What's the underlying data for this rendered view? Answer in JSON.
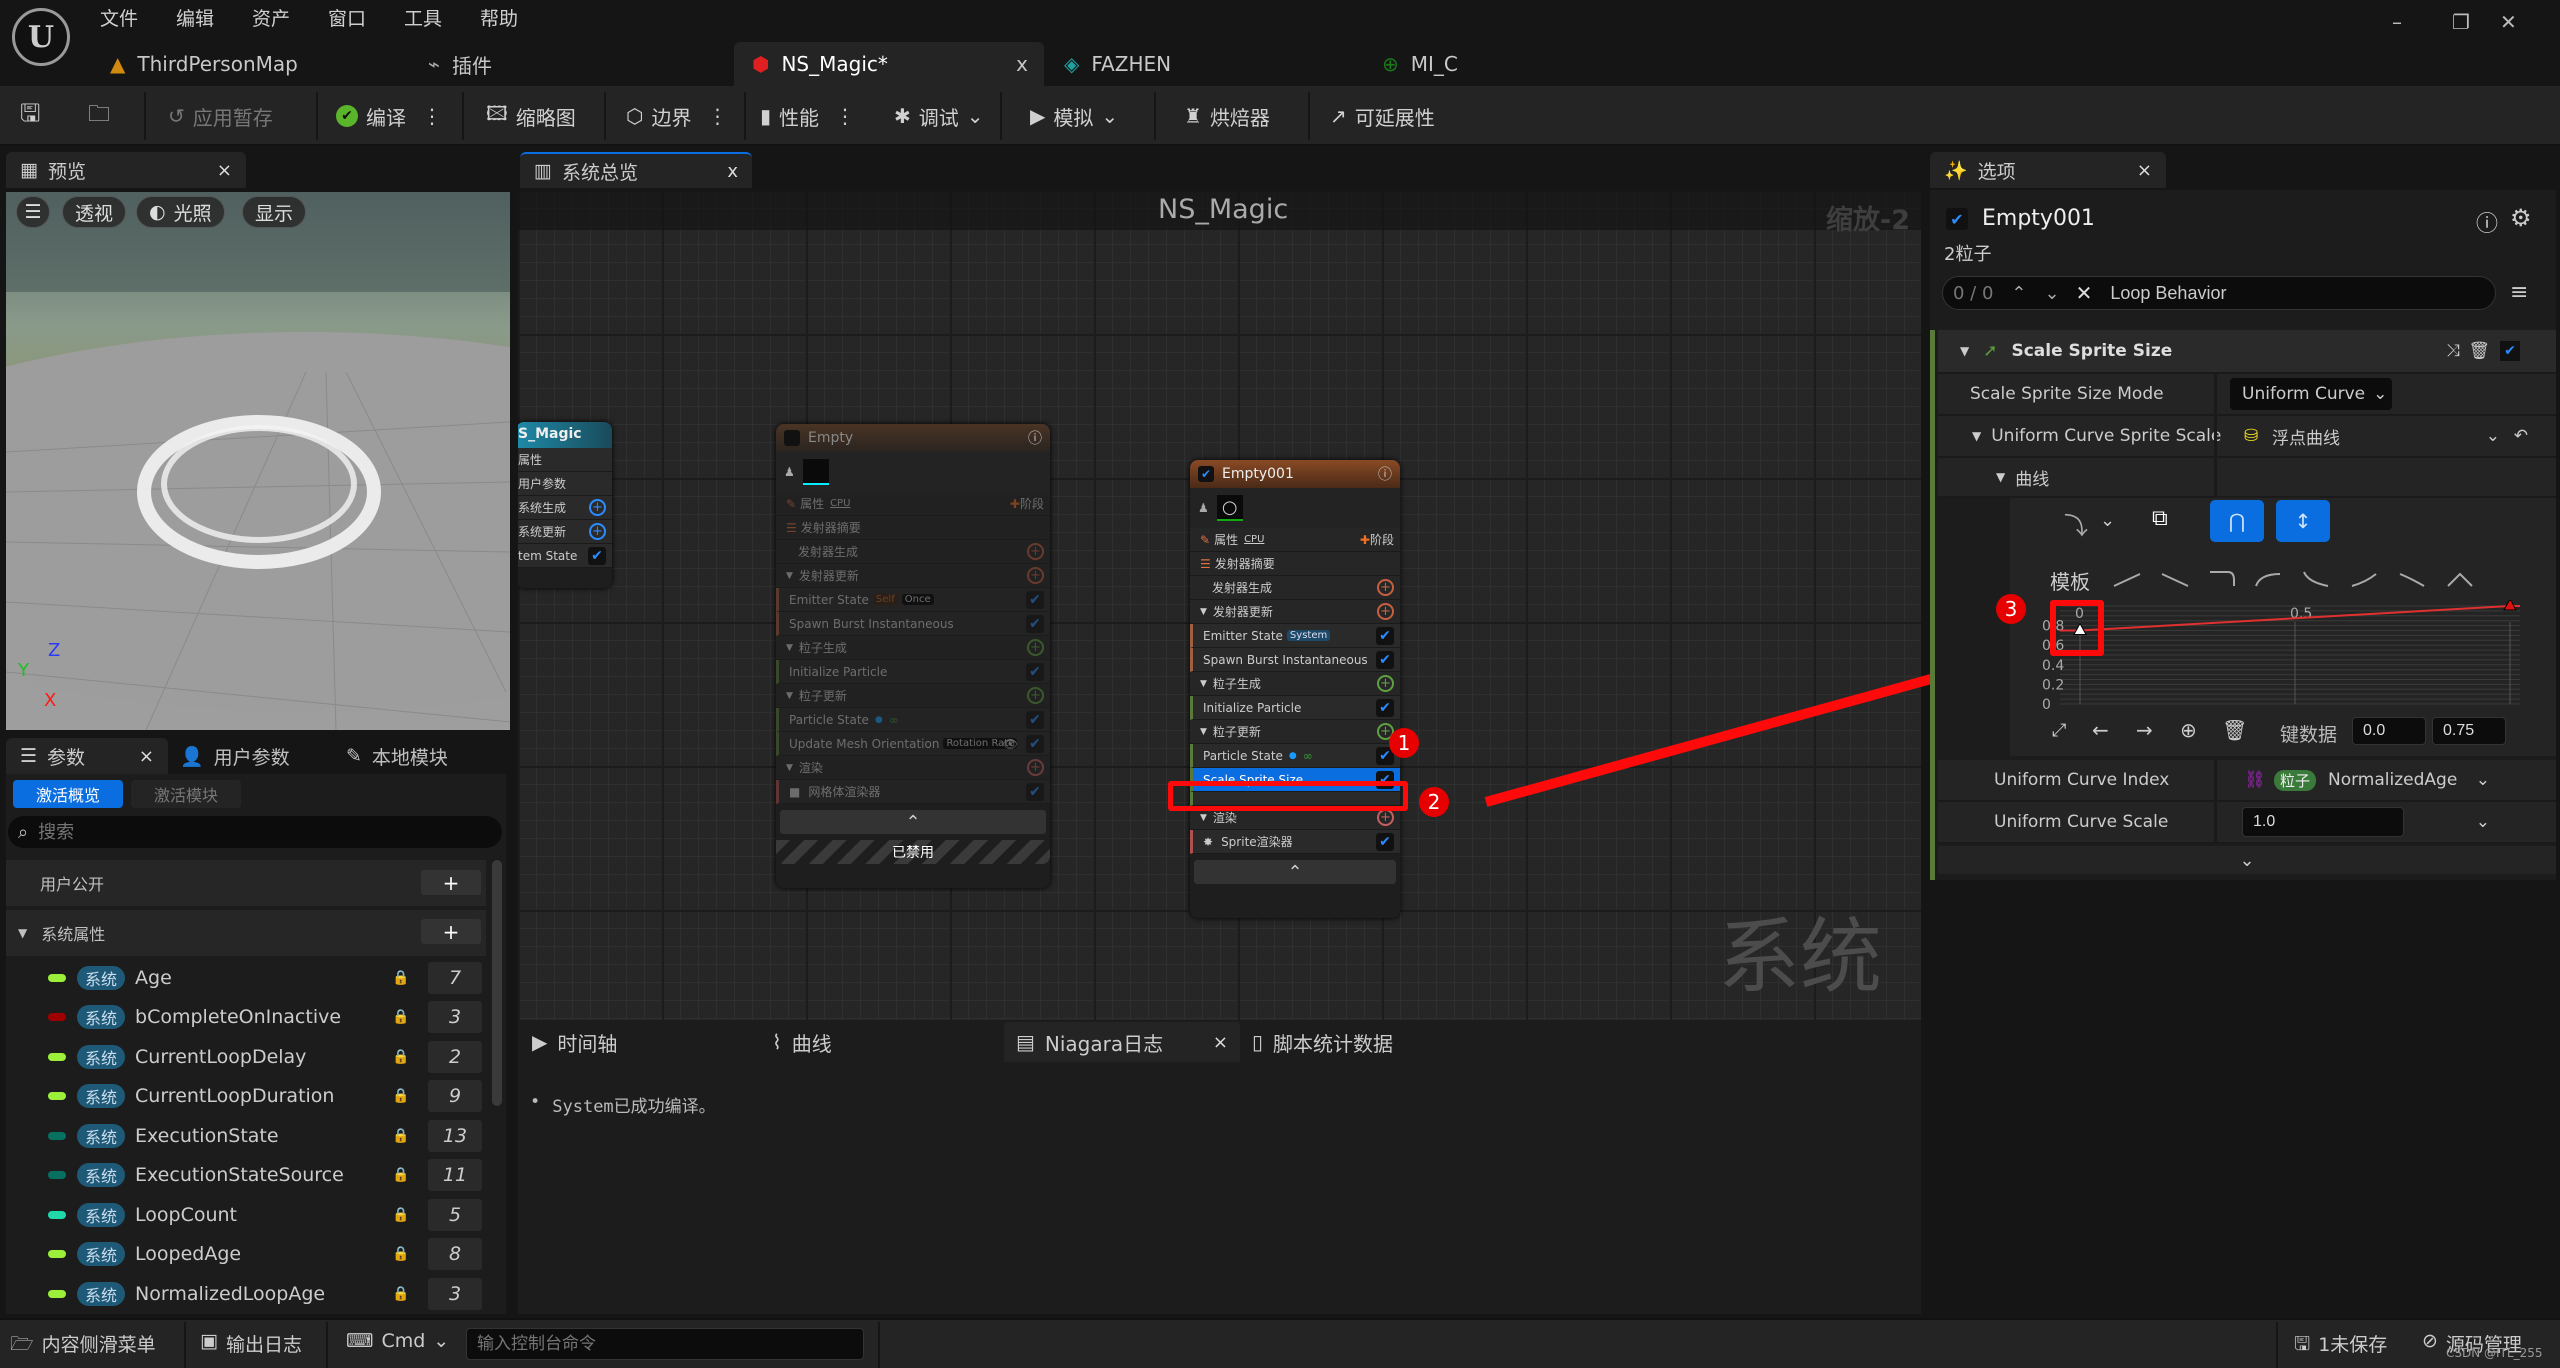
{
  "menu": [
    "文件",
    "编辑",
    "资产",
    "窗口",
    "工具",
    "帮助"
  ],
  "logo": "U",
  "window_controls": {
    "minimize": "–",
    "restore": "❐",
    "close": "✕"
  },
  "doc_tabs": [
    {
      "label": "ThirdPersonMap",
      "icon": "level-icon",
      "color": "#d08a10"
    },
    {
      "label": "插件",
      "icon": "plugin-icon",
      "color": "#aaaaaa"
    },
    {
      "label": "NS_Magic*",
      "icon": "niagara-system-icon",
      "color": "#e02020",
      "active": true,
      "close": "x"
    },
    {
      "label": "FAZHEN",
      "icon": "niagara-emitter-icon",
      "color": "#20a0a0"
    },
    {
      "label": "MI_C",
      "icon": "material-instance-icon",
      "color": "#1a7a1a"
    }
  ],
  "toolbar": {
    "apply": "应用暂存",
    "compile": "编译",
    "thumbnail": "缩略图",
    "bounds": "边界",
    "performance": "性能",
    "debug": "调试",
    "simulate": "模拟",
    "baker": "烘焙器",
    "scalability": "可延展性"
  },
  "preview": {
    "tab": "预览",
    "close": "×",
    "buttons": {
      "menu": "☰",
      "perspective": "透视",
      "lighting": "光照",
      "show": "显示"
    },
    "axes": {
      "z": "Z",
      "y": "Y",
      "x": "X"
    }
  },
  "params": {
    "tabs": [
      {
        "label": "参数",
        "close": "×"
      },
      {
        "label": "用户参数"
      },
      {
        "label": "本地模块"
      }
    ],
    "filter_active": "激活概览",
    "filter_inactive": "激活模块",
    "search_placeholder": "搜索",
    "user_exposed": "用户公开",
    "system_attrs": "系统属性",
    "add": "+",
    "badge": "系统",
    "items": [
      {
        "name": "Age",
        "count": "7",
        "color": "#9cf03a"
      },
      {
        "name": "bCompleteOnInactive",
        "count": "3",
        "color": "#a00000"
      },
      {
        "name": "CurrentLoopDelay",
        "count": "2",
        "color": "#9cf03a"
      },
      {
        "name": "CurrentLoopDuration",
        "count": "9",
        "color": "#9cf03a"
      },
      {
        "name": "ExecutionState",
        "count": "13",
        "color": "#087060"
      },
      {
        "name": "ExecutionStateSource",
        "count": "11",
        "color": "#087060"
      },
      {
        "name": "LoopCount",
        "count": "5",
        "color": "#20d8a8"
      },
      {
        "name": "LoopedAge",
        "count": "8",
        "color": "#9cf03a"
      },
      {
        "name": "NormalizedLoopAge",
        "count": "3",
        "color": "#9cf03a"
      }
    ]
  },
  "graph": {
    "tab": "系统总览",
    "close": "x",
    "title": "NS_Magic",
    "zoom": "缩放-2",
    "watermark": "系统",
    "system_node": {
      "title": "S_Magic",
      "rows": [
        "属性",
        "用户参数",
        "系统生成",
        "系统更新",
        "tem State"
      ]
    },
    "empty_node": {
      "title": "Empty",
      "props": "属性",
      "cpu": "CPU",
      "stage": "阶段",
      "summary": "发射器摘要",
      "emitter_spawn": "发射器生成",
      "emitter_update": "发射器更新",
      "emitter_state": "Emitter State",
      "tag_self": "Self",
      "tag_once": "Once",
      "spawn_burst": "Spawn Burst Instantaneous",
      "particle_spawn": "粒子生成",
      "init_particle": "Initialize Particle",
      "particle_update": "粒子更新",
      "particle_state": "Particle State",
      "update_mesh": "Update Mesh Orientation",
      "tag_rotation": "Rotation Rate",
      "render": "渲染",
      "mesh_renderer": "网格体渲染器",
      "disabled": "已禁用"
    },
    "empty001_node": {
      "title": "Empty001",
      "props": "属性",
      "cpu": "CPU",
      "stage": "阶段",
      "summary": "发射器摘要",
      "emitter_spawn": "发射器生成",
      "emitter_update": "发射器更新",
      "emitter_state": "Emitter State",
      "tag_system": "System",
      "spawn_burst": "Spawn Burst Instantaneous",
      "particle_spawn": "粒子生成",
      "init_particle": "Initialize Particle",
      "particle_update": "粒子更新",
      "particle_state": "Particle State",
      "scale_sprite": "Scale Sprite Size",
      "render": "渲染",
      "sprite_renderer": "Sprite渲染器"
    }
  },
  "annotations": {
    "one": "1",
    "two": "2",
    "three": "3"
  },
  "bottom_tabs": [
    {
      "label": "时间轴"
    },
    {
      "label": "曲线"
    },
    {
      "label": "Niagara日志",
      "close": "×",
      "active": true
    },
    {
      "label": "脚本统计数据"
    }
  ],
  "log": [
    "System已成功编译。"
  ],
  "details": {
    "tab": "选项",
    "close": "×",
    "emitter": "Empty001",
    "particles": "2粒子",
    "search_count": "0 / 0",
    "search_value": "Loop Behavior",
    "module": "Scale Sprite Size",
    "mode_label": "Scale Sprite Size Mode",
    "mode_value": "Uniform Curve",
    "ucss_label": "Uniform Curve Sprite Scale",
    "ucss_value": "浮点曲线",
    "curve_label": "曲线",
    "templates_label": "模板",
    "key_data_label": "键数据",
    "key_time": "0.0",
    "key_value": "0.75",
    "uci_label": "Uniform Curve Index",
    "uci_badge": "粒子",
    "uci_value": "NormalizedAge",
    "ucs_label": "Uniform Curve Scale",
    "ucs_value": "1.0"
  },
  "curve_chart": {
    "x_ticks": [
      "0",
      "0.5"
    ],
    "y_ticks": [
      "0",
      "0.2",
      "0.4",
      "0.6",
      "0.8"
    ],
    "keys": [
      {
        "time": 0.0,
        "value": 0.75
      },
      {
        "time": 1.0,
        "value": 1.0
      }
    ]
  },
  "statusbar": {
    "content_drawer": "内容侧滑菜单",
    "output_log": "输出日志",
    "cmd": "Cmd",
    "console_placeholder": "输入控制台命令",
    "unsaved": "1未保存",
    "source_control": "源码管理",
    "watermark": "CSDN @ITL_255"
  }
}
